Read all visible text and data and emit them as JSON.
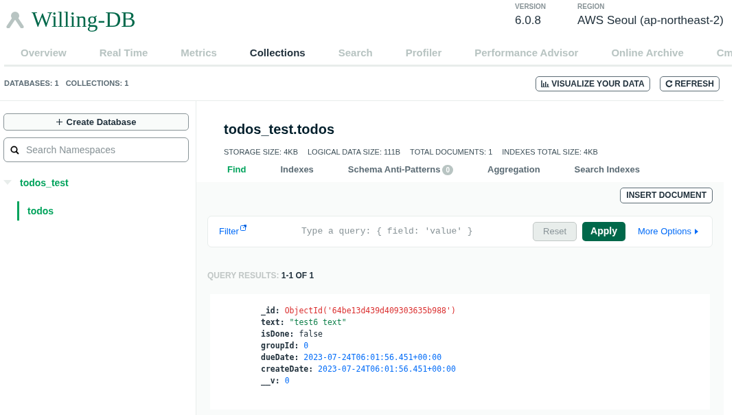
{
  "project": {
    "name": "Willing-DB"
  },
  "meta": [
    {
      "label": "VERSION",
      "value": "6.0.8"
    },
    {
      "label": "REGION",
      "value": "AWS Seoul (ap-northeast-2)"
    }
  ],
  "tabs": [
    {
      "label": "Overview",
      "selected": false
    },
    {
      "label": "Real Time",
      "selected": false
    },
    {
      "label": "Metrics",
      "selected": false
    },
    {
      "label": "Collections",
      "selected": true
    },
    {
      "label": "Search",
      "selected": false
    },
    {
      "label": "Profiler",
      "selected": false
    },
    {
      "label": "Performance Advisor",
      "selected": false
    },
    {
      "label": "Online Archive",
      "selected": false
    },
    {
      "label": "Cm",
      "selected": false
    }
  ],
  "counts": [
    {
      "label": "DATABASES:",
      "value": "1"
    },
    {
      "label": "COLLECTIONS:",
      "value": "1"
    }
  ],
  "actions": [
    "VISUALIZE YOUR DATA",
    "REFRESH"
  ],
  "sidebar": {
    "create_button": "Create Database",
    "search_placeholder": "Search Namespaces",
    "tree": [
      {
        "label": "todos_test",
        "expanded": true,
        "children": [
          {
            "label": "todos",
            "selected": true
          }
        ]
      }
    ]
  },
  "collection": {
    "title": "todos_test.todos",
    "stats": [
      {
        "label": "STORAGE SIZE:",
        "value": "4KB"
      },
      {
        "label": "LOGICAL DATA SIZE:",
        "value": "111B"
      },
      {
        "label": "TOTAL DOCUMENTS:",
        "value": "1"
      },
      {
        "label": "INDEXES TOTAL SIZE:",
        "value": "4KB"
      }
    ],
    "tabs": [
      {
        "label": "Find",
        "selected": true
      },
      {
        "label": "Indexes",
        "selected": false
      },
      {
        "label": "Schema Anti-Patterns",
        "badge": "0",
        "selected": false
      },
      {
        "label": "Aggregation",
        "selected": false
      },
      {
        "label": "Search Indexes",
        "selected": false
      }
    ],
    "insert_button": "INSERT DOCUMENT",
    "filter": {
      "label": "Filter",
      "placeholder": "Type a query: { field: 'value' }",
      "reset": "Reset",
      "apply": "Apply",
      "more": "More Options"
    },
    "results": {
      "label": "QUERY RESULTS:",
      "value": "1-1 OF 1"
    },
    "document": [
      {
        "key": "_id:",
        "value": "ObjectId('64be13d439d409303635b988')",
        "kind": "objectid"
      },
      {
        "key": "text:",
        "value": "\"test6 text\"",
        "kind": "string"
      },
      {
        "key": "isDone:",
        "value": "false",
        "kind": "boolean"
      },
      {
        "key": "groupId:",
        "value": "0",
        "kind": "number"
      },
      {
        "key": "dueDate:",
        "value": "2023-07-24T06:01:56.451+00:00",
        "kind": "date"
      },
      {
        "key": "createDate:",
        "value": "2023-07-24T06:01:56.451+00:00",
        "kind": "date"
      },
      {
        "key": "__v:",
        "value": "0",
        "kind": "number"
      }
    ]
  }
}
